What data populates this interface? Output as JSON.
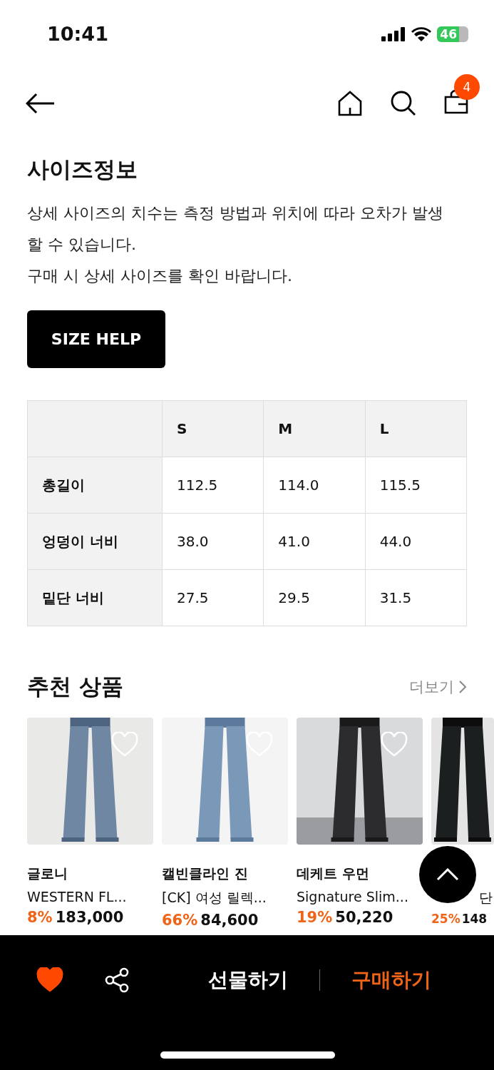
{
  "status_bar": {
    "time": "10:41",
    "battery": "46"
  },
  "header": {
    "cart_count": "4"
  },
  "size_info": {
    "title": "사이즈정보",
    "description": [
      "상세 사이즈의 치수는 측정 방법과 위치에 따라 오차가 발생할 수 있습니다.",
      "구매 시 상세 사이즈를 확인 바랍니다."
    ],
    "help_button": "SIZE HELP"
  },
  "size_table": {
    "columns": [
      "S",
      "M",
      "L"
    ],
    "rows": [
      {
        "label": "총길이",
        "values": [
          "112.5",
          "114.0",
          "115.5"
        ]
      },
      {
        "label": "엉덩이 너비",
        "values": [
          "38.0",
          "41.0",
          "44.0"
        ]
      },
      {
        "label": "밑단 너비",
        "values": [
          "27.5",
          "29.5",
          "31.5"
        ]
      }
    ]
  },
  "recommended": {
    "title": "추천 상품",
    "more": "더보기",
    "products": [
      {
        "brand": "글로니",
        "name": "WESTERN FL...",
        "discount": "8%",
        "price": "183,000",
        "liked": false,
        "kind": "full"
      },
      {
        "brand": "캘빈클라인 진",
        "name": "[CK] 여성 릴렉...",
        "discount": "66%",
        "price": "84,600",
        "liked": false,
        "kind": "full"
      },
      {
        "brand": "데케트 우먼",
        "name": "Signature Slim...",
        "discount": "19%",
        "price": "50,220",
        "liked": false,
        "kind": "full"
      },
      {
        "name": "단",
        "discount": "25%",
        "price": "148",
        "kind": "partial"
      }
    ]
  },
  "bottom_bar": {
    "liked": true,
    "gift": "선물하기",
    "buy": "구매하기"
  }
}
